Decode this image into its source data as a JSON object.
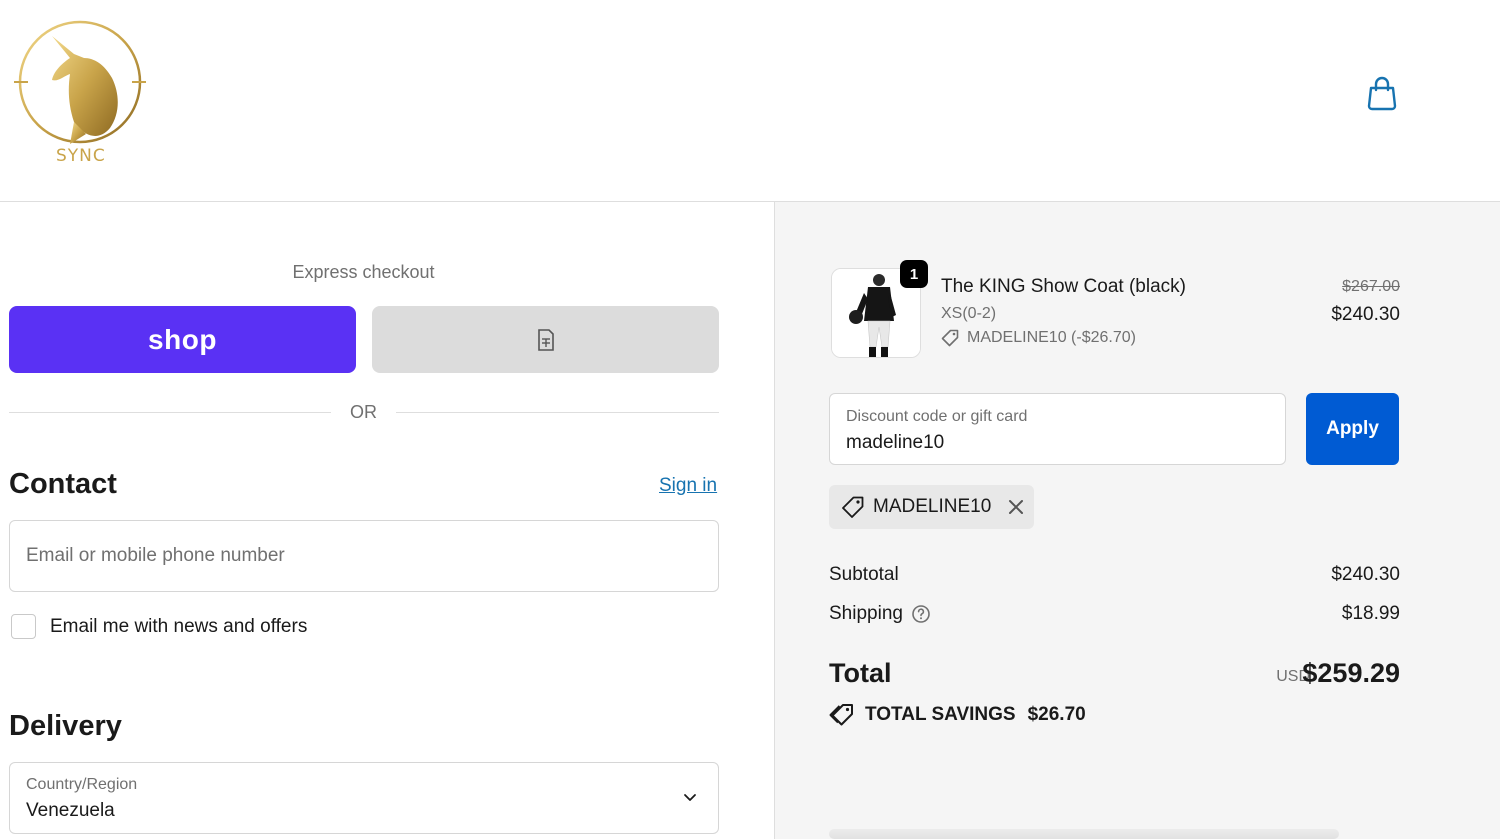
{
  "header": {
    "logo_text": "SYNC"
  },
  "express": {
    "label": "Express checkout",
    "shop_label": "shop",
    "or_label": "OR"
  },
  "contact": {
    "title": "Contact",
    "signin": "Sign in",
    "email_placeholder": "Email or mobile phone number",
    "newsletter_label": "Email me with news and offers"
  },
  "delivery": {
    "title": "Delivery",
    "country_label": "Country/Region",
    "country_value": "Venezuela"
  },
  "order": {
    "item": {
      "quantity": "1",
      "name": "The KING Show Coat (black)",
      "variant": "XS(0-2)",
      "discount": "MADELINE10 (-$26.70)",
      "old_price": "$267.00",
      "price": "$240.30"
    },
    "discount_field": {
      "label": "Discount code or gift card",
      "value": "madeline10"
    },
    "apply_label": "Apply",
    "applied_code": "MADELINE10",
    "subtotal_label": "Subtotal",
    "subtotal_value": "$240.30",
    "shipping_label": "Shipping",
    "shipping_value": "$18.99",
    "total_label": "Total",
    "total_currency": "USD",
    "total_value": "$259.29",
    "savings_label": "TOTAL SAVINGS",
    "savings_value": "$26.70"
  },
  "colors": {
    "shop_purple": "#5a31f4",
    "apply_blue": "#005bd3",
    "link_blue": "#1773b0",
    "logo_gold": "#c9a44a"
  },
  "icons": [
    "cart-bag-icon",
    "receipt-icon",
    "chevron-down-icon",
    "tag-icon",
    "close-icon",
    "help-circle-icon",
    "savings-tag-icon"
  ]
}
